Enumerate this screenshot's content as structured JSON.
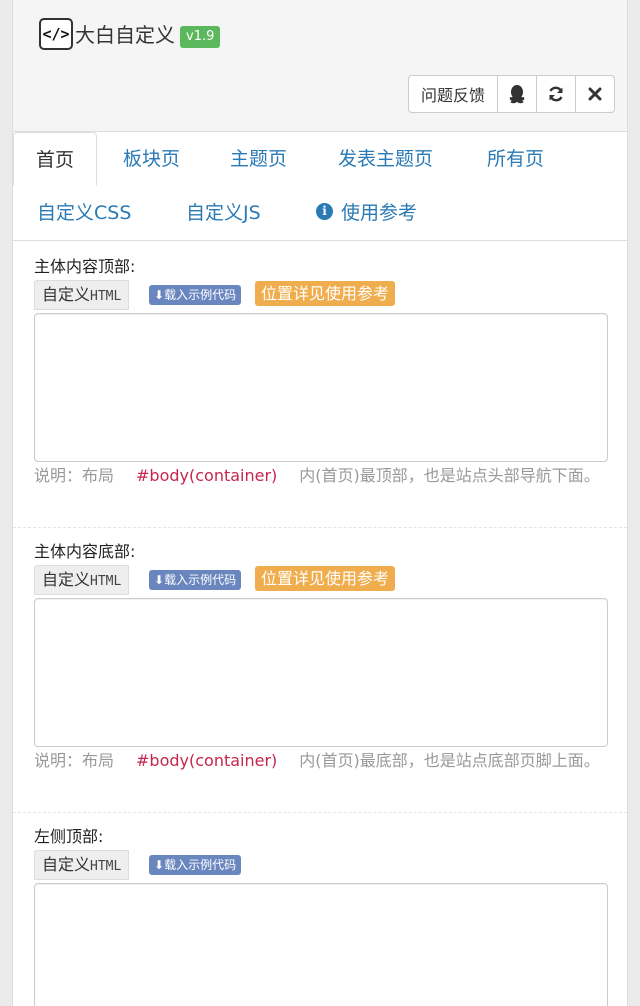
{
  "header": {
    "logo_glyph": "</>",
    "title": "大白自定义",
    "version": "v1.9",
    "buttons": {
      "feedback": "问题反馈",
      "qq_icon": "qq-icon",
      "refresh_icon": "refresh-icon",
      "close_icon": "close-icon"
    }
  },
  "tabs": [
    {
      "label": "首页",
      "active": true
    },
    {
      "label": "板块页"
    },
    {
      "label": "主题页"
    },
    {
      "label": "发表主题页"
    },
    {
      "label": "所有页"
    },
    {
      "label": "自定义CSS"
    },
    {
      "label": "自定义JS"
    },
    {
      "label": "使用参考",
      "icon": "info-icon"
    }
  ],
  "sections": [
    {
      "title": "主体内容顶部:",
      "addon_prefix": "自定义",
      "addon_code": "HTML",
      "load_example": "载入示例代码",
      "position_ref": "位置详见使用参考",
      "help_prefix": "说明：布局",
      "help_code": "#body(container)",
      "help_suffix": "内(首页)最顶部，也是站点头部导航下面。"
    },
    {
      "title": "主体内容底部:",
      "addon_prefix": "自定义",
      "addon_code": "HTML",
      "load_example": "载入示例代码",
      "position_ref": "位置详见使用参考",
      "help_prefix": "说明：布局",
      "help_code": "#body(container)",
      "help_suffix": "内(首页)最底部，也是站点底部页脚上面。"
    },
    {
      "title": "左侧顶部:",
      "addon_prefix": "自定义",
      "addon_code": "HTML",
      "load_example": "载入示例代码"
    }
  ],
  "colors": {
    "link": "#2a7ab5",
    "success": "#5cb85c",
    "warning": "#f0ad4e",
    "primary_label": "#6a86bf",
    "code": "#c7254e"
  }
}
